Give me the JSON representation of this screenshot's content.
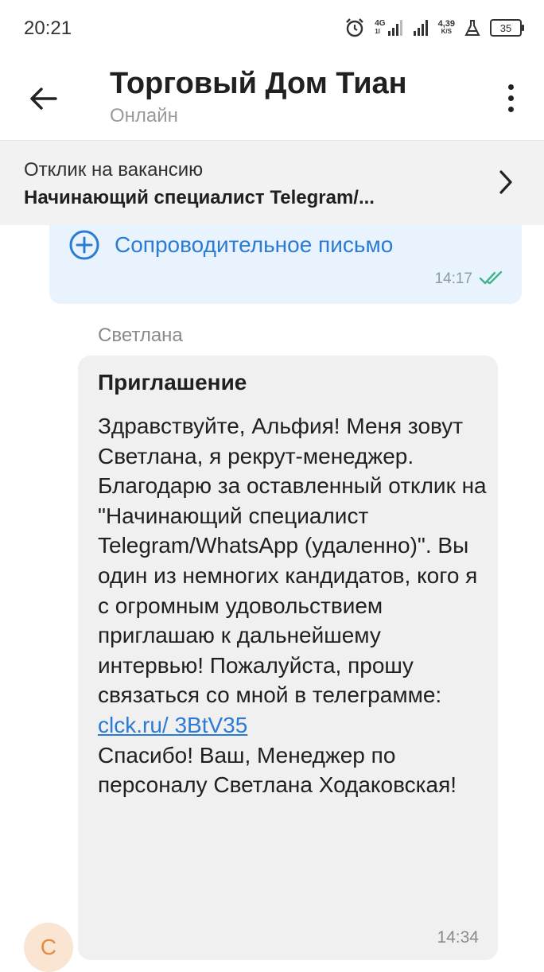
{
  "status_bar": {
    "time": "20:21",
    "network": "4G",
    "network_sub": "1l",
    "speed_value": "4,39",
    "speed_unit": "K/S",
    "battery": "35",
    "icons": [
      "alarm-icon",
      "signal-icon",
      "signal-icon",
      "flask-icon",
      "battery-icon"
    ]
  },
  "header": {
    "title": "Торговый Дом Тиан",
    "subtitle": "Онлайн",
    "back_icon": "arrow-left-icon",
    "menu_icon": "more-vertical-icon"
  },
  "vacancy_banner": {
    "label": "Отклик на вакансию",
    "title": "Начинающий специалист Telegram/...",
    "icon": "chevron-right-icon"
  },
  "outgoing_message": {
    "cover_letter_label": "Сопроводительное письмо",
    "time": "14:17",
    "status_icon": "double-check-icon",
    "colors": {
      "bubble": "#e8f3fd",
      "accent": "#2b7bd4",
      "check": "#3fb68b"
    }
  },
  "incoming_message": {
    "sender": "Светлана",
    "title": "Приглашение",
    "body_before_link": "Здравствуйте, Альфия! Меня зовут Светлана, я рекрут-менеджер. Благодарю за оставленный отклик на \"Начинающий специалист Telegram/WhatsApp (удаленно)\". Вы один из немногих кандидатов, кого я с огромным удовольствием приглашаю к дальнейшему интервью! Пожалуйста, прошу связаться со мной в телеграмме: ",
    "link": "clck.ru/ 3BtV35",
    "body_after_link": "Спасибо! Ваш, Менеджер по персоналу Светлана Ходаковская!",
    "time": "14:34",
    "avatar_letter": "С"
  }
}
